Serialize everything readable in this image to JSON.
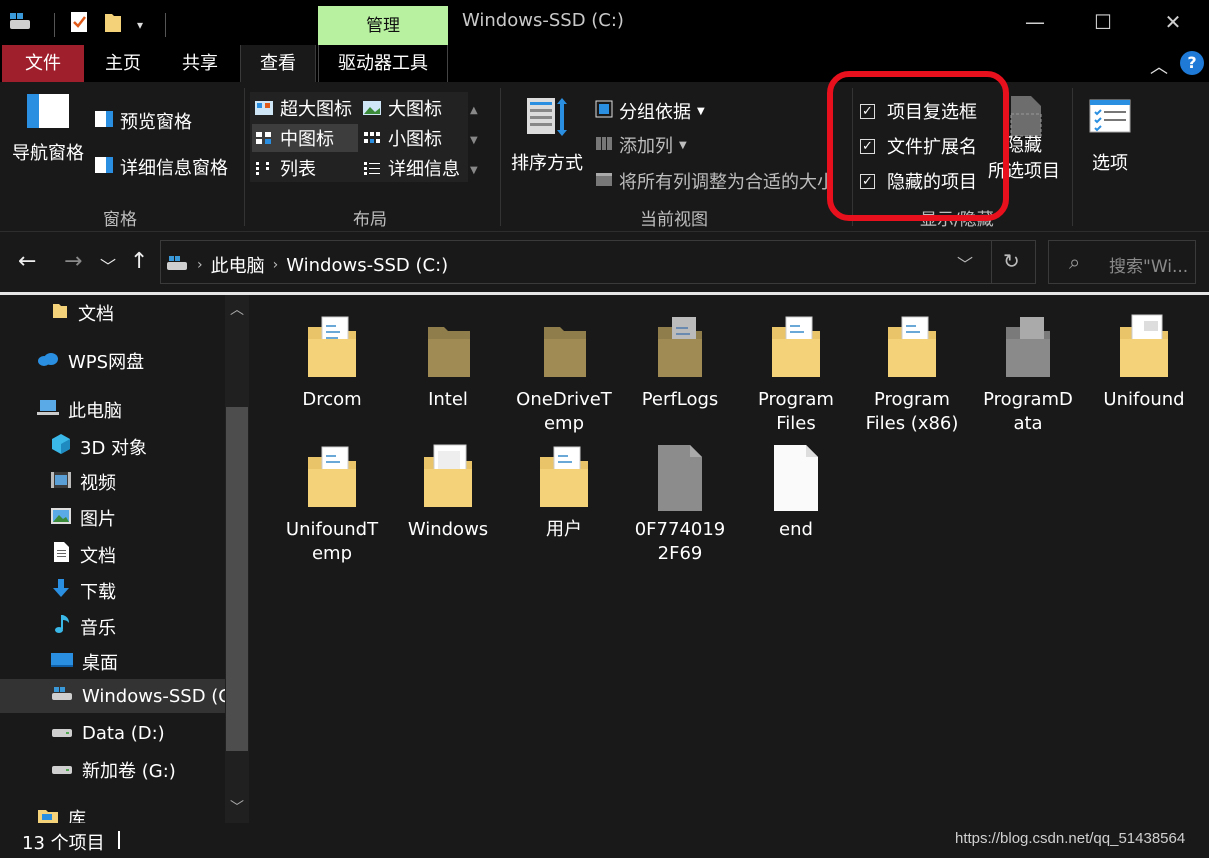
{
  "title_bar": {
    "context_tab": "管理",
    "window_title": "Windows-SSD (C:)",
    "minimize": "—",
    "maximize": "☐",
    "close": "✕"
  },
  "ribbon_tabs": [
    "文件",
    "主页",
    "共享",
    "查看",
    "驱动器工具"
  ],
  "help_label": "?",
  "ribbon": {
    "panes": {
      "navigation_pane": "导航窗格",
      "preview_pane": "预览窗格",
      "details_pane": "详细信息窗格",
      "label": "窗格"
    },
    "layout": {
      "items": [
        "超大图标",
        "大图标",
        "中图标",
        "小图标",
        "列表",
        "详细信息"
      ],
      "selected": "中图标",
      "label": "布局"
    },
    "current_view": {
      "sort_by": "排序方式",
      "group_by": "分组依据",
      "add_columns": "添加列",
      "size_columns": "将所有列调整为合适的大小",
      "label": "当前视图"
    },
    "show_hide": {
      "item_checkboxes": "项目复选框",
      "file_extensions": "文件扩展名",
      "hidden_items": "隐藏的项目",
      "hide_selected_line1": "隐藏",
      "hide_selected_line2": "所选项目",
      "options": "选项",
      "label": "显示/隐藏",
      "checked": [
        true,
        true,
        true
      ]
    }
  },
  "address_bar": {
    "breadcrumb": [
      "此电脑",
      "Windows-SSD (C:)"
    ],
    "search_placeholder": "搜索\"Wi..."
  },
  "nav_pane": [
    {
      "label": "文档",
      "icon": "folder-icon"
    },
    {
      "label": "WPS网盘",
      "icon": "cloud-icon"
    },
    {
      "label": "此电脑",
      "icon": "computer-icon"
    },
    {
      "label": "3D 对象",
      "icon": "cube-icon"
    },
    {
      "label": "视频",
      "icon": "video-icon"
    },
    {
      "label": "图片",
      "icon": "picture-icon"
    },
    {
      "label": "文档",
      "icon": "document-icon"
    },
    {
      "label": "下载",
      "icon": "download-icon"
    },
    {
      "label": "音乐",
      "icon": "music-icon"
    },
    {
      "label": "桌面",
      "icon": "desktop-icon"
    },
    {
      "label": "Windows-SSD (C",
      "icon": "drive-icon"
    },
    {
      "label": "Data (D:)",
      "icon": "drive-icon"
    },
    {
      "label": "新加卷 (G:)",
      "icon": "drive-icon"
    },
    {
      "label": "库",
      "icon": "library-icon"
    }
  ],
  "files": [
    {
      "name": "Drcom",
      "type": "folder-docs"
    },
    {
      "name": "Intel",
      "type": "folder-hidden"
    },
    {
      "name": "OneDriveTemp",
      "type": "folder-hidden"
    },
    {
      "name": "PerfLogs",
      "type": "folder-hidden-docs"
    },
    {
      "name": "Program Files",
      "type": "folder-docs"
    },
    {
      "name": "Program Files (x86)",
      "type": "folder-docs"
    },
    {
      "name": "ProgramData",
      "type": "folder-gray"
    },
    {
      "name": "Unifound",
      "type": "folder-white"
    },
    {
      "name": "UnifoundTemp",
      "type": "folder-docs"
    },
    {
      "name": "Windows",
      "type": "folder-white"
    },
    {
      "name": "用户",
      "type": "folder-docs"
    },
    {
      "name": "0F7740192F69",
      "type": "file-gray"
    },
    {
      "name": "end",
      "type": "file-white"
    }
  ],
  "file_labels": {
    "drcom": "Drcom",
    "intel": "Intel",
    "onedrive_1": "OneDriveT",
    "onedrive_2": "emp",
    "perflogs": "PerfLogs",
    "pf_1": "Program",
    "pf_2": "Files",
    "pf86_1": "Program",
    "pf86_2": "Files (x86)",
    "pd_1": "ProgramD",
    "pd_2": "ata",
    "unifound": "Unifound",
    "ut_1": "UnifoundT",
    "ut_2": "emp",
    "windows": "Windows",
    "users": "用户",
    "hex_1": "0F774019",
    "hex_2": "2F69",
    "end": "end"
  },
  "status_bar": {
    "item_count": "13 个项目",
    "watermark": "https://blog.csdn.net/qq_51438564"
  },
  "colors": {
    "file_tab": "#a01f2c",
    "context_tab": "#b8f2a0",
    "highlight_box": "#e8101c",
    "folder": "#f3d27a",
    "hidden_folder": "#8f7d4c"
  }
}
